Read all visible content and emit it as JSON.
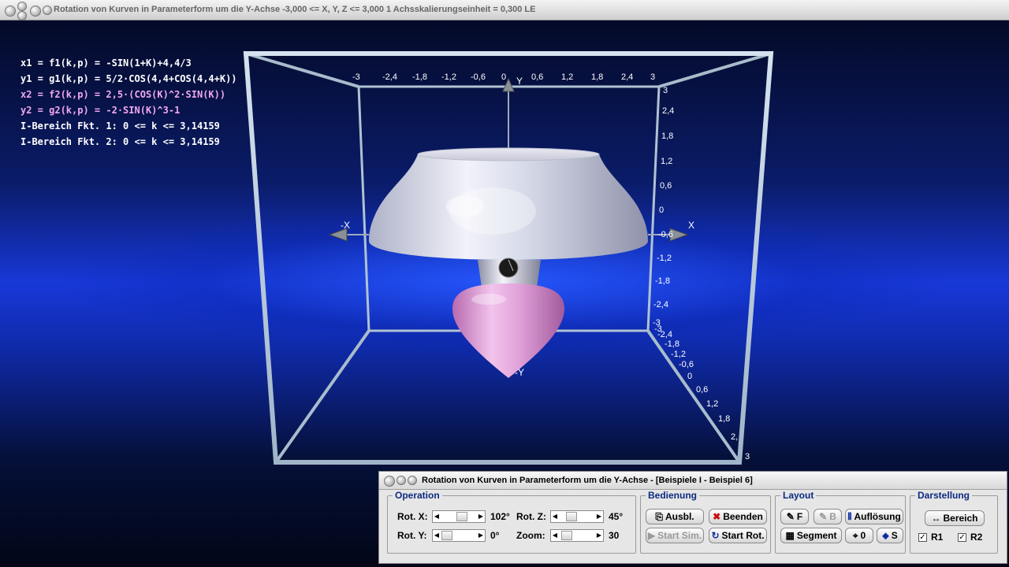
{
  "window": {
    "title": "Rotation von Kurven in Parameterform um die Y-Achse   -3,000 <= X, Y, Z <= 3,000    1 Achsskalierungseinheit = 0,300 LE"
  },
  "formulas": {
    "x1": "x1 = f1(k,p) = -SIN(1+K)+4,4/3",
    "y1": "y1 = g1(k,p) = 5/2·COS(4,4+COS(4,4+K))",
    "x2": "x2 = f2(k,p) = 2,5·(COS(K)^2·SIN(K))",
    "y2": "y2 = g2(k,p) = -2·SIN(K)^3-1",
    "range1": "I-Bereich Fkt. 1: 0 <= k <= 3,14159",
    "range2": "I-Bereich Fkt. 2: 0 <= k <= 3,14159"
  },
  "axes": {
    "x_top_ticks": [
      "-3",
      "-2,4",
      "-1,8",
      "-1,2",
      "-0,6",
      "0",
      "0,6",
      "1,2",
      "1,8",
      "2,4",
      "3"
    ],
    "y_right_ticks": [
      "3",
      "2,4",
      "1,8",
      "1,2",
      "0,6",
      "0",
      "-0,6",
      "-1,2",
      "-1,8",
      "-2,4",
      "-3"
    ],
    "z_ticks": [
      "-3",
      "-2,4",
      "-1,8",
      "-1,2",
      "-0,6",
      "0",
      "0,6",
      "1,2",
      "1,8",
      "2,",
      "3"
    ],
    "label_y": "Y",
    "label_neg_y": "-Y",
    "label_x": "X",
    "label_neg_x": "-X"
  },
  "panel": {
    "title": "Rotation von Kurven in Parameterform um die Y-Achse - [Beispiele I - Beispiel 6]",
    "operation": {
      "label": "Operation",
      "rot_x_label": "Rot. X:",
      "rot_x_value": "102°",
      "rot_y_label": "Rot. Y:",
      "rot_y_value": "0°",
      "rot_z_label": "Rot. Z:",
      "rot_z_value": "45°",
      "zoom_label": "Zoom:",
      "zoom_value": "30"
    },
    "bedienung": {
      "label": "Bedienung",
      "ausbl": "Ausbl.",
      "beenden": "Beenden",
      "start_sim": "Start Sim.",
      "start_rot": "Start Rot."
    },
    "layout": {
      "label": "Layout",
      "f": "F",
      "b": "B",
      "aufloesung": "Auflösung",
      "segment": "Segment",
      "zero": "0",
      "s": "S"
    },
    "darstellung": {
      "label": "Darstellung",
      "bereich": "Bereich",
      "r1": "R1",
      "r2": "R2",
      "r1_checked": true,
      "r2_checked": true
    }
  },
  "colors": {
    "surface1": "#d8dcf0",
    "surface2": "#e6a8dc",
    "frame": "#b8cadc",
    "accent_blue": "#1838d8"
  }
}
